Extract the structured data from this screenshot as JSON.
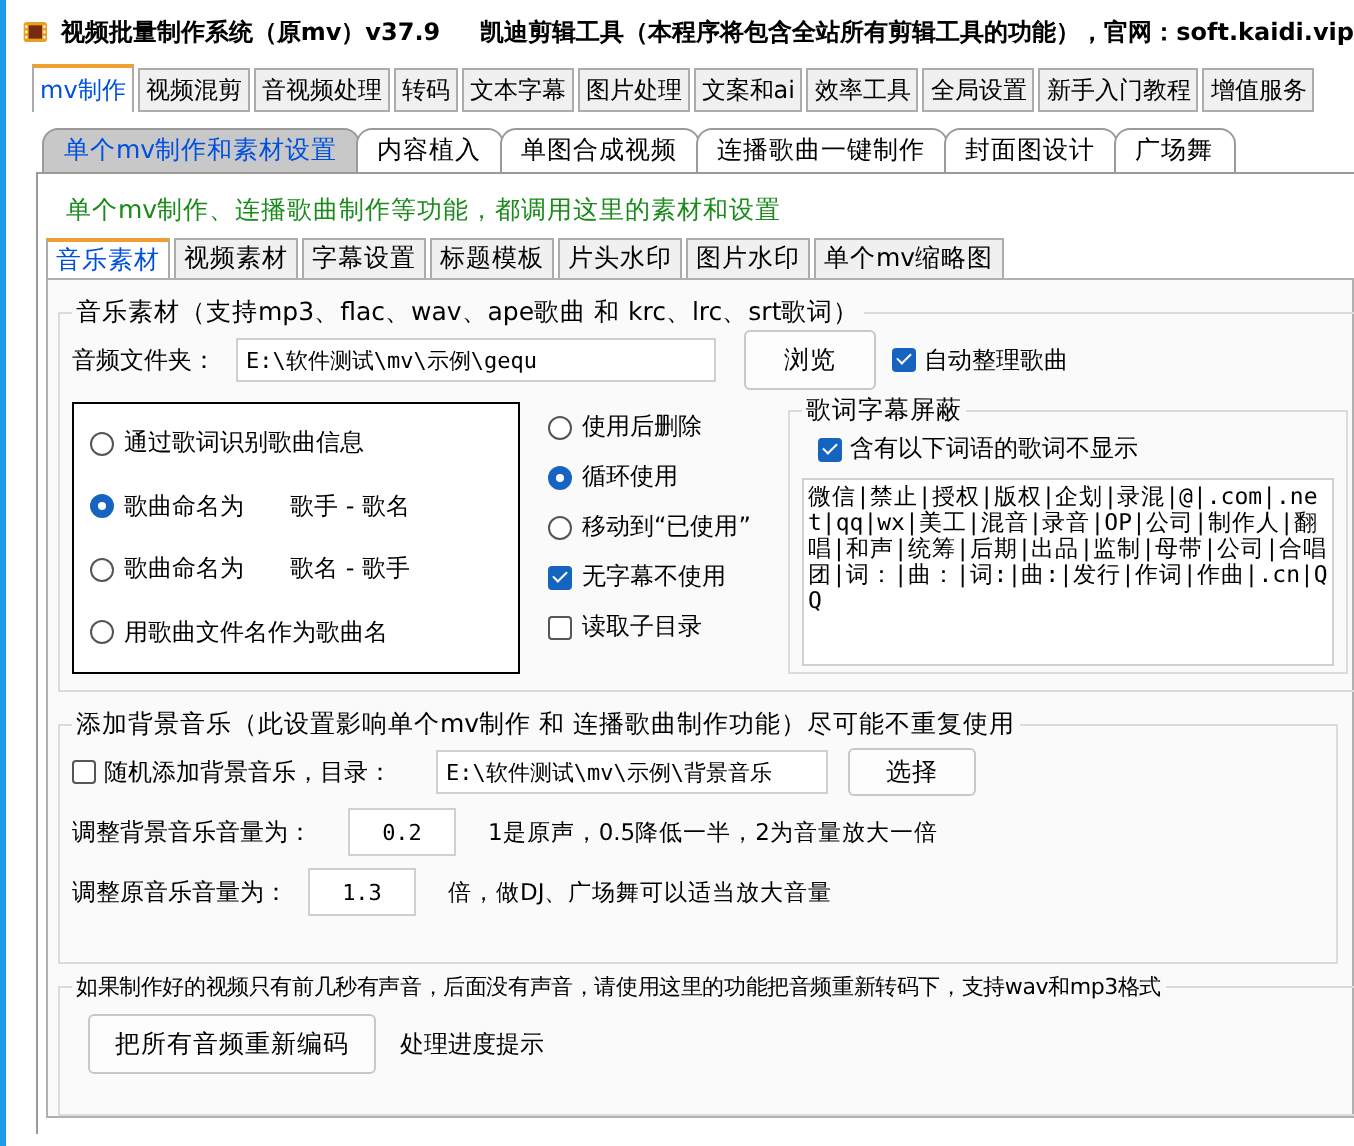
{
  "window": {
    "title": "视频批量制作系统（原mv）v37.9",
    "subtitle": "凯迪剪辑工具（本程序将包含全站所有剪辑工具的功能），官网：soft.kaidi.vip"
  },
  "main_tabs": [
    {
      "label": "mv制作",
      "selected": true
    },
    {
      "label": "视频混剪",
      "selected": false
    },
    {
      "label": "音视频处理",
      "selected": false
    },
    {
      "label": "转码",
      "selected": false
    },
    {
      "label": "文本字幕",
      "selected": false
    },
    {
      "label": "图片处理",
      "selected": false
    },
    {
      "label": "文案和ai",
      "selected": false
    },
    {
      "label": "效率工具",
      "selected": false
    },
    {
      "label": "全局设置",
      "selected": false
    },
    {
      "label": "新手入门教程",
      "selected": false
    },
    {
      "label": "增值服务",
      "selected": false
    }
  ],
  "sub_tabs": [
    {
      "label": "单个mv制作和素材设置",
      "selected": true
    },
    {
      "label": "内容植入",
      "selected": false
    },
    {
      "label": "单图合成视频",
      "selected": false
    },
    {
      "label": "连播歌曲一键制作",
      "selected": false
    },
    {
      "label": "封面图设计",
      "selected": false
    },
    {
      "label": "广场舞",
      "selected": false
    }
  ],
  "notice": "单个mv制作、连播歌曲制作等功能，都调用这里的素材和设置",
  "inner_tabs": [
    {
      "label": "音乐素材",
      "selected": true
    },
    {
      "label": "视频素材",
      "selected": false
    },
    {
      "label": "字幕设置",
      "selected": false
    },
    {
      "label": "标题模板",
      "selected": false
    },
    {
      "label": "片头水印",
      "selected": false
    },
    {
      "label": "图片水印",
      "selected": false
    },
    {
      "label": "单个mv缩略图",
      "selected": false
    }
  ],
  "music_group": {
    "title": "音乐素材（支持mp3、flac、wav、ape歌曲 和 krc、lrc、srt歌词）",
    "folder_label": "音频文件夹：",
    "folder_value": "E:\\软件测试\\mv\\示例\\gequ",
    "browse_button": "浏览",
    "auto_sort": {
      "label": "自动整理歌曲",
      "checked": true
    },
    "naming_options": [
      {
        "label": "通过歌词识别歌曲信息",
        "selected": false
      },
      {
        "label": "歌曲命名为",
        "detail": "歌手 - 歌名",
        "selected": true
      },
      {
        "label": "歌曲命名为",
        "detail": "歌名 - 歌手",
        "selected": false
      },
      {
        "label": "用歌曲文件名作为歌曲名",
        "selected": false
      }
    ],
    "usage_options": [
      {
        "kind": "radio",
        "label": "使用后删除",
        "selected": false
      },
      {
        "kind": "radio",
        "label": "循环使用",
        "selected": true
      },
      {
        "kind": "radio",
        "label": "移动到“已使用”",
        "selected": false
      },
      {
        "kind": "checkbox",
        "label": "无字幕不使用",
        "checked": true
      },
      {
        "kind": "checkbox",
        "label": "读取子目录",
        "checked": false
      }
    ]
  },
  "lyrics_filter": {
    "title": "歌词字幕屏蔽",
    "option": {
      "label": "含有以下词语的歌词不显示",
      "checked": true
    },
    "words": "微信|禁止|授权|版权|企划|录混|@|.com|.net|qq|wx|美工|混音|录音|OP|公司|制作人|翻唱|和声|统筹|后期|出品|监制|母带|公司|合唱团|词：|曲：|词:|曲:|发行|作词|作曲|.cn|QQ"
  },
  "bg_music": {
    "title": "添加背景音乐（此设置影响单个mv制作 和 连播歌曲制作功能）尽可能不重复使用",
    "random": {
      "label": "随机添加背景音乐，目录：",
      "checked": false
    },
    "folder_value": "E:\\软件测试\\mv\\示例\\背景音乐",
    "select_button": "选择",
    "bg_volume": {
      "label": "调整背景音乐音量为：",
      "value": "0.2",
      "hint": "1是原声，0.5降低一半，2为音量放大一倍"
    },
    "orig_volume": {
      "label": "调整原音乐音量为：",
      "value": "1.3",
      "hint": "倍，做DJ、广场舞可以适当放大音量"
    }
  },
  "reencode": {
    "title": "如果制作好的视频只有前几秒有声音，后面没有声音，请使用这里的功能把音频重新转码下，支持wav和mp3格式",
    "button": "把所有音频重新编码",
    "status": "处理进度提示"
  }
}
